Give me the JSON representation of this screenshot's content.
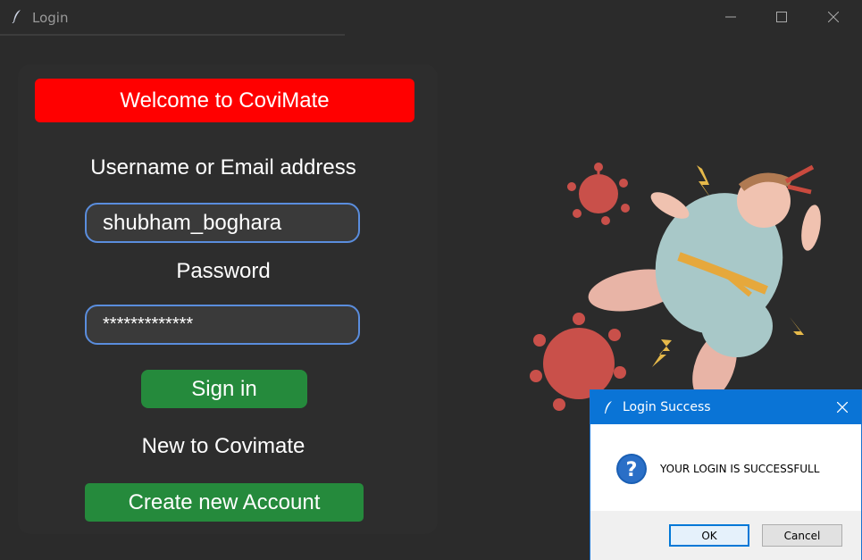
{
  "window": {
    "title": "Login",
    "icon": "feather-icon"
  },
  "login": {
    "welcome_text": "Welcome to CoviMate",
    "username_label": "Username or Email address",
    "username_value": "shubham_boghara",
    "password_label": "Password",
    "password_value": "*************",
    "signin_label": "Sign in",
    "new_user_text": "New to Covimate",
    "create_account_label": "Create new Account"
  },
  "dialog": {
    "title": "Login Success",
    "message": "YOUR LOGIN IS SUCCESSFULL",
    "ok_label": "OK",
    "cancel_label": "Cancel",
    "icon": "question-icon"
  },
  "colors": {
    "welcome_bg": "#ff0000",
    "button_green": "#258a3c",
    "field_border": "#5a8ddd",
    "dialog_titlebar": "#0a74d6"
  }
}
